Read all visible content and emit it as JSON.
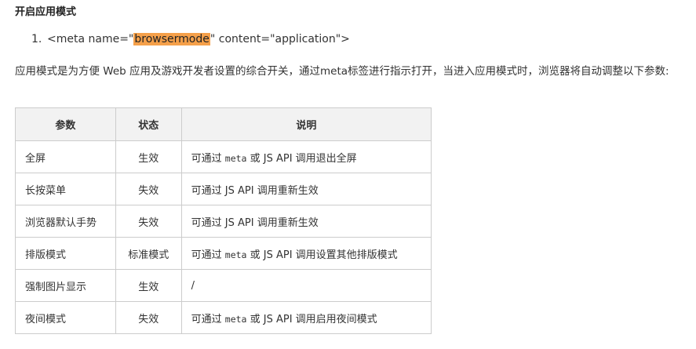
{
  "heading": "开启应用模式",
  "code": {
    "number": "1.",
    "before": "<meta name=\"",
    "highlight": "browsermode",
    "after": "\" content=\"application\">"
  },
  "paragraph": "应用模式是为方便 Web 应用及游戏开发者设置的综合开关，通过meta标签进行指示打开，当进入应用模式时，浏览器将自动调整以下参数:",
  "table": {
    "headers": [
      "参数",
      "状态",
      "说明"
    ],
    "rows": [
      {
        "param": "全屏",
        "state": "生效",
        "desc": [
          {
            "t": "可通过 "
          },
          {
            "t": "meta",
            "mono": true
          },
          {
            "t": " 或 JS API 调用退出全屏"
          }
        ]
      },
      {
        "param": "长按菜单",
        "state": "失效",
        "desc": [
          {
            "t": "可通过 JS API 调用重新生效"
          }
        ]
      },
      {
        "param": "浏览器默认手势",
        "state": "失效",
        "desc": [
          {
            "t": "可通过 JS API 调用重新生效"
          }
        ]
      },
      {
        "param": "排版模式",
        "state": "标准模式",
        "desc": [
          {
            "t": "可通过 "
          },
          {
            "t": "meta",
            "mono": true
          },
          {
            "t": " 或 JS API 调用设置其他排版模式"
          }
        ]
      },
      {
        "param": "强制图片显示",
        "state": "生效",
        "desc": [
          {
            "t": "/"
          }
        ]
      },
      {
        "param": "夜间模式",
        "state": "失效",
        "desc": [
          {
            "t": "可通过 "
          },
          {
            "t": "meta",
            "mono": true
          },
          {
            "t": " 或 JS API 调用启用夜间模式"
          }
        ]
      }
    ]
  },
  "colors": {
    "highlight": "#f5a04a",
    "header_bg": "#f2f2f2",
    "border": "#cccccc"
  }
}
